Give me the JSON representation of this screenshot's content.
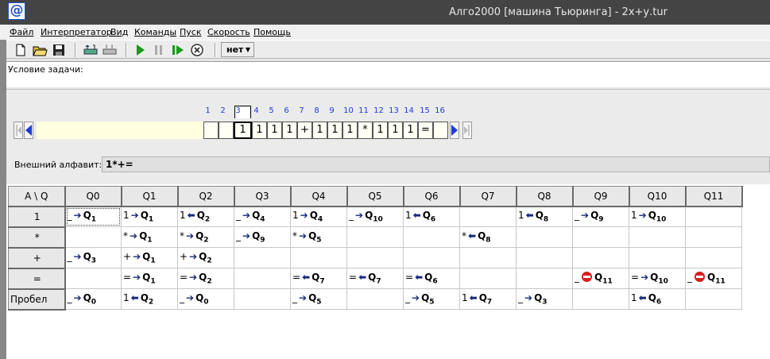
{
  "window": {
    "title": "Алго2000 [машина Тьюринга] - 2х+у.tur",
    "icon": "at-icon"
  },
  "menu": [
    "Файл",
    "Интерпретатор",
    "Вид",
    "Команды",
    "Пуск",
    "Скорость",
    "Помощь"
  ],
  "toolbar": {
    "speed": "нет"
  },
  "condition": {
    "label": "Условие задачи:"
  },
  "tape": {
    "indices": [
      "1",
      "2",
      "3",
      "4",
      "5",
      "6",
      "7",
      "8",
      "9",
      "10",
      "11",
      "12",
      "13",
      "14",
      "15",
      "16"
    ],
    "cells": [
      "",
      "",
      "1",
      "1",
      "1",
      "1",
      "+",
      "1",
      "1",
      "1",
      "*",
      "1",
      "1",
      "1",
      "=",
      ""
    ],
    "current_index": 3
  },
  "alphabet": {
    "label": "Внешний алфавит:",
    "value": "1*+="
  },
  "table": {
    "corner": "A \\ Q",
    "states": [
      "Q0",
      "Q1",
      "Q2",
      "Q3",
      "Q4",
      "Q5",
      "Q6",
      "Q7",
      "Q8",
      "Q9",
      "Q10",
      "Q11"
    ],
    "rows": [
      {
        "symbol": "1",
        "cells": [
          {
            "w": "_",
            "d": "R",
            "s": "Q",
            "n": "1"
          },
          {
            "w": "1",
            "d": "R",
            "s": "Q",
            "n": "1"
          },
          {
            "w": "1",
            "d": "L",
            "s": "Q",
            "n": "2"
          },
          {
            "w": "_",
            "d": "R",
            "s": "Q",
            "n": "4"
          },
          {
            "w": "1",
            "d": "R",
            "s": "Q",
            "n": "4"
          },
          {
            "w": "_",
            "d": "R",
            "s": "Q",
            "n": "10"
          },
          {
            "w": "1",
            "d": "L",
            "s": "Q",
            "n": "6"
          },
          null,
          {
            "w": "1",
            "d": "L",
            "s": "Q",
            "n": "8"
          },
          {
            "w": "_",
            "d": "R",
            "s": "Q",
            "n": "9"
          },
          {
            "w": "1",
            "d": "R",
            "s": "Q",
            "n": "10"
          },
          null
        ]
      },
      {
        "symbol": "*",
        "cells": [
          null,
          {
            "w": "*",
            "d": "R",
            "s": "Q",
            "n": "1"
          },
          {
            "w": "*",
            "d": "R",
            "s": "Q",
            "n": "2"
          },
          {
            "w": "_",
            "d": "R",
            "s": "Q",
            "n": "9"
          },
          {
            "w": "*",
            "d": "R",
            "s": "Q",
            "n": "5"
          },
          null,
          null,
          {
            "w": "*",
            "d": "L",
            "s": "Q",
            "n": "8"
          },
          null,
          null,
          null,
          null
        ]
      },
      {
        "symbol": "+",
        "cells": [
          {
            "w": "_",
            "d": "R",
            "s": "Q",
            "n": "3"
          },
          {
            "w": "+",
            "d": "R",
            "s": "Q",
            "n": "1"
          },
          {
            "w": "+",
            "d": "R",
            "s": "Q",
            "n": "2"
          },
          null,
          null,
          null,
          null,
          null,
          null,
          null,
          null,
          null
        ]
      },
      {
        "symbol": "=",
        "cells": [
          null,
          {
            "w": "=",
            "d": "R",
            "s": "Q",
            "n": "1"
          },
          {
            "w": "=",
            "d": "R",
            "s": "Q",
            "n": "2"
          },
          null,
          {
            "w": "=",
            "d": "L",
            "s": "Q",
            "n": "7"
          },
          {
            "w": "=",
            "d": "L",
            "s": "Q",
            "n": "7"
          },
          {
            "w": "=",
            "d": "L",
            "s": "Q",
            "n": "6"
          },
          null,
          null,
          {
            "w": "_",
            "d": "S",
            "s": "Q",
            "n": "11"
          },
          {
            "w": "=",
            "d": "R",
            "s": "Q",
            "n": "10"
          },
          {
            "w": "_",
            "d": "S",
            "s": "Q",
            "n": "11"
          }
        ]
      },
      {
        "symbol": "Пробел",
        "cells": [
          {
            "w": "_",
            "d": "R",
            "s": "Q",
            "n": "0"
          },
          {
            "w": "1",
            "d": "L",
            "s": "Q",
            "n": "2"
          },
          {
            "w": "_",
            "d": "R",
            "s": "Q",
            "n": "0"
          },
          null,
          {
            "w": "_",
            "d": "R",
            "s": "Q",
            "n": "5"
          },
          null,
          {
            "w": "_",
            "d": "R",
            "s": "Q",
            "n": "5"
          },
          {
            "w": "1",
            "d": "L",
            "s": "Q",
            "n": "7"
          },
          {
            "w": "_",
            "d": "R",
            "s": "Q",
            "n": "3"
          },
          null,
          {
            "w": "1",
            "d": "L",
            "s": "Q",
            "n": "6"
          },
          null
        ]
      }
    ]
  },
  "colors": {
    "tape_strip": "#ffffe0",
    "index_text": "#1c3cd6",
    "arrow": "#1a2a7a",
    "stop": "#d42020"
  }
}
